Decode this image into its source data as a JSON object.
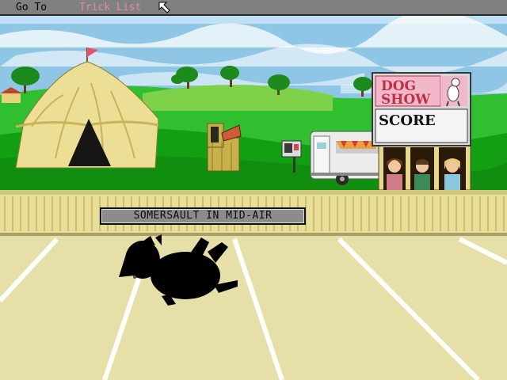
{
  "menu": {
    "goto_label": "Go To",
    "tricks_label": "Trick List"
  },
  "sign": {
    "line1": "DOG",
    "line2": "SHOW",
    "score_label": "SCORE"
  },
  "trick_caption": "SOMERSAULT IN MID-AIR",
  "icons": [
    "arrow-cursor-icon",
    "mailbox-icon",
    "flag-icon"
  ],
  "colors": {
    "menubar": "#808080",
    "menu_text": "#000000",
    "menu_highlight": "#e58a9a",
    "sky": "#8fc6e6",
    "grass": "#1fb81f",
    "arena_sand": "#e6e0a8",
    "fence": "#e8de96",
    "tent": "#ecdf95",
    "sign_pink": "#f0b8c8",
    "sign_red": "#c0304a",
    "dog": "#000000"
  }
}
